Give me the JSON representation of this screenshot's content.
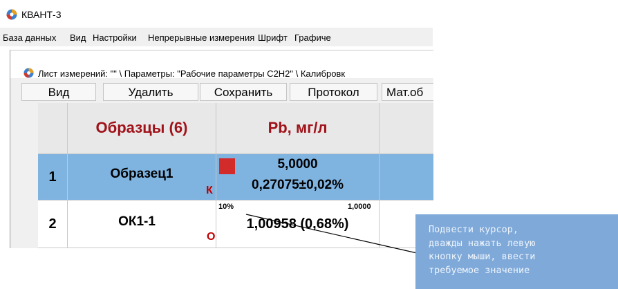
{
  "app": {
    "title": "КВАНТ-3"
  },
  "menu": [
    "База данных",
    "Вид",
    "Настройки",
    "Непрерывные измерения",
    "Шрифт",
    "Графиче"
  ],
  "sheet": {
    "title": "Лист измерений: \"\" \\ Параметры: \"Рабочие параметры С2Н2\" \\ Калибровк"
  },
  "toolbar": [
    "Вид",
    "Удалить",
    "Сохранить",
    "Протокол",
    "Мат.об"
  ],
  "grid": {
    "headers": {
      "samples": "Образцы (6)",
      "pb": "Pb, мг/л"
    },
    "rows": [
      {
        "num": "1",
        "name": "Образец1",
        "flag": "К",
        "value": "5,0000",
        "detail": "0,27075±0,02%",
        "marker": "red-square"
      },
      {
        "num": "2",
        "name": "ОК1-1",
        "flag": "О",
        "percent": "10%",
        "target": "1,0000",
        "value": "1,00958 (0,68%)"
      }
    ]
  },
  "callout": {
    "lines": [
      "Подвести курсор,",
      "дважды нажать левую",
      "кнопку мыши, ввести",
      "требуемое значение"
    ]
  },
  "colors": {
    "header_text": "#a0121a",
    "selected_row": "#7fb3e0",
    "marker": "#d32a2a",
    "callout_bg": "#7fa9d9"
  }
}
